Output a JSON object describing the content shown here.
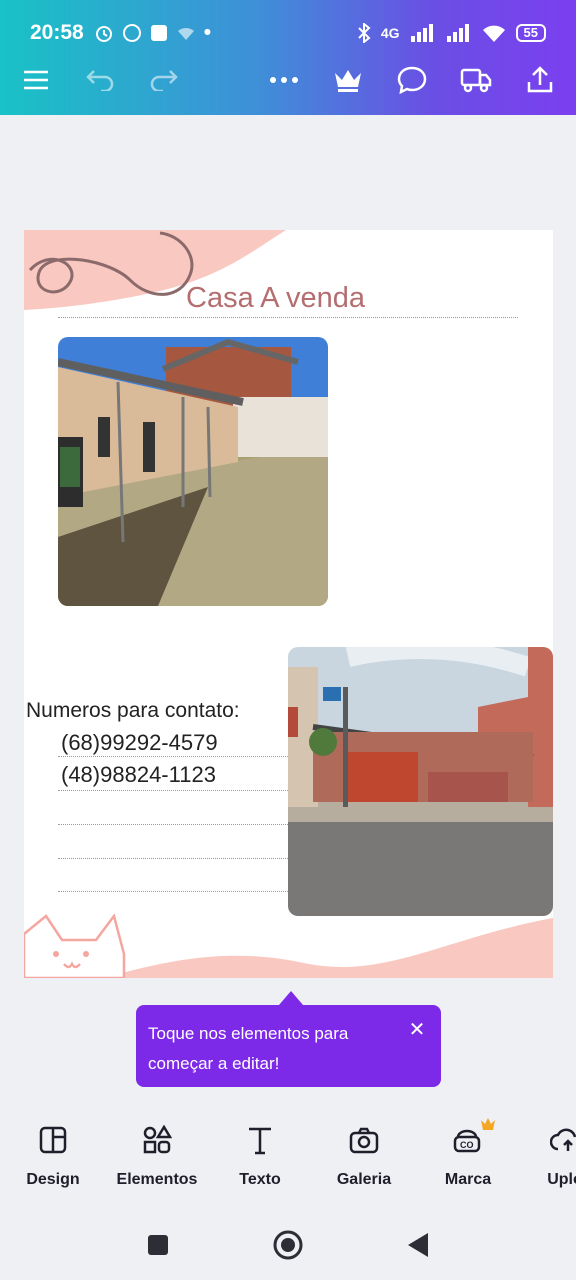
{
  "status": {
    "time": "20:58",
    "network": "4G",
    "battery": "55"
  },
  "toolbar": {
    "menu_icon": "hamburger-menu-icon",
    "undo_icon": "undo-icon",
    "redo_icon": "redo-icon",
    "more_icon": "more-icon",
    "premium_icon": "crown-icon",
    "comment_icon": "comment-icon",
    "delivery_icon": "truck-icon",
    "share_icon": "share-icon"
  },
  "design": {
    "title": "Casa A venda",
    "contact_title": "Numeros para contato:",
    "phones": [
      "(68)99292-4579",
      "(48)98824-1123"
    ]
  },
  "tooltip": {
    "text": "Toque nos elementos para começar a editar!",
    "close_glyph": "✕"
  },
  "tools": [
    {
      "label": "Design",
      "icon": "layout-icon"
    },
    {
      "label": "Elementos",
      "icon": "shapes-icon"
    },
    {
      "label": "Texto",
      "icon": "text-icon"
    },
    {
      "label": "Galeria",
      "icon": "camera-icon"
    },
    {
      "label": "Marca",
      "icon": "brand-icon"
    },
    {
      "label": "Uplo",
      "icon": "upload-icon"
    }
  ],
  "colors": {
    "accent": "#7d2ae8",
    "title": "#b46e70",
    "pink": "#f9c8c0"
  }
}
